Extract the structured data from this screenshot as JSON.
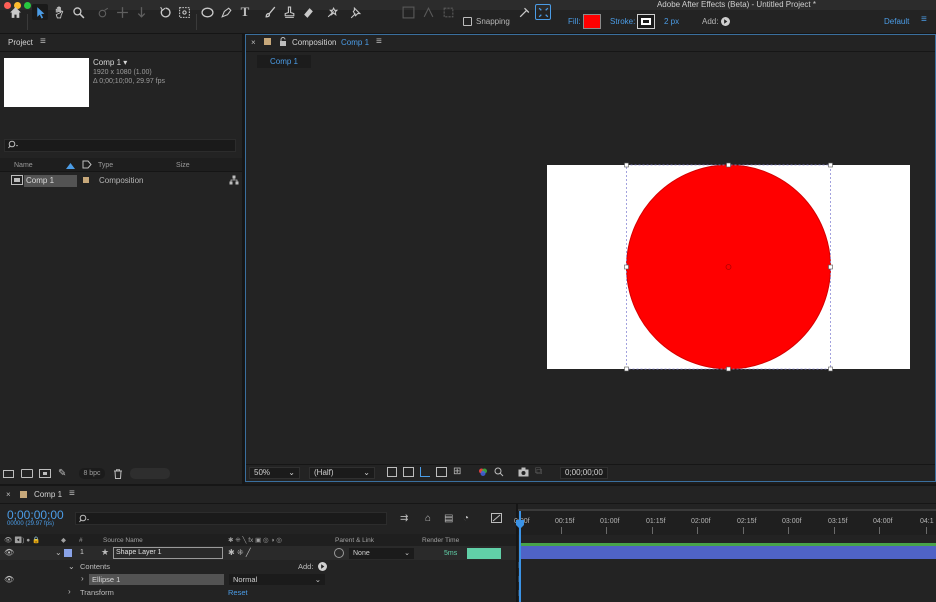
{
  "app": {
    "title": "Adobe After Effects (Beta) - Untitled Project *"
  },
  "toolbar": {
    "snapping_label": "Snapping",
    "fill_label": "Fill:",
    "fill_color": "#ff0000",
    "stroke_label": "Stroke:",
    "stroke_width": "2 px",
    "add_label": "Add:",
    "workspace_label": "Default"
  },
  "project_panel": {
    "title": "Project",
    "comp_name": "Comp 1 ▾",
    "comp_resolution": "1920 x 1080 (1.00)",
    "comp_duration": "Δ 0;00;10;00, 29.97 fps",
    "columns": [
      "Name",
      "Type",
      "Size"
    ],
    "items": [
      {
        "name": "Comp 1",
        "type": "Composition",
        "size": ""
      }
    ],
    "bpc_label": "8 bpc"
  },
  "composition_viewer": {
    "panel_label": "Composition",
    "comp_name": "Comp 1",
    "subtab": "Comp 1",
    "zoom": "50%",
    "resolution": "(Half)",
    "timecode": "0;00;00;00",
    "canvas_color": "#ffffff",
    "shape_color": "#ff0000"
  },
  "timeline": {
    "tab_label": "Comp 1",
    "timecode": "0;00;00;00",
    "timecode_sub": "00000 (29.97 fps)",
    "columns": {
      "number": "#",
      "source_name": "Source Name",
      "parent_link": "Parent & Link",
      "render_time": "Render Time"
    },
    "layer": {
      "index": "1",
      "name": "Shape Layer 1",
      "parent": "None",
      "render_time": "5ms"
    },
    "contents_label": "Contents",
    "add_label": "Add:",
    "ellipse_label": "Ellipse 1",
    "blend_mode": "Normal",
    "transform_label": "Transform",
    "reset_label": "Reset",
    "ruler_labels": [
      "0:00f",
      "00:15f",
      "01:00f",
      "01:15f",
      "02:00f",
      "02:15f",
      "03:00f",
      "03:15f",
      "04:00f",
      "04:1"
    ],
    "colors": {
      "layer_bar": "#4f63c6",
      "label": "#8aa3e8"
    }
  }
}
